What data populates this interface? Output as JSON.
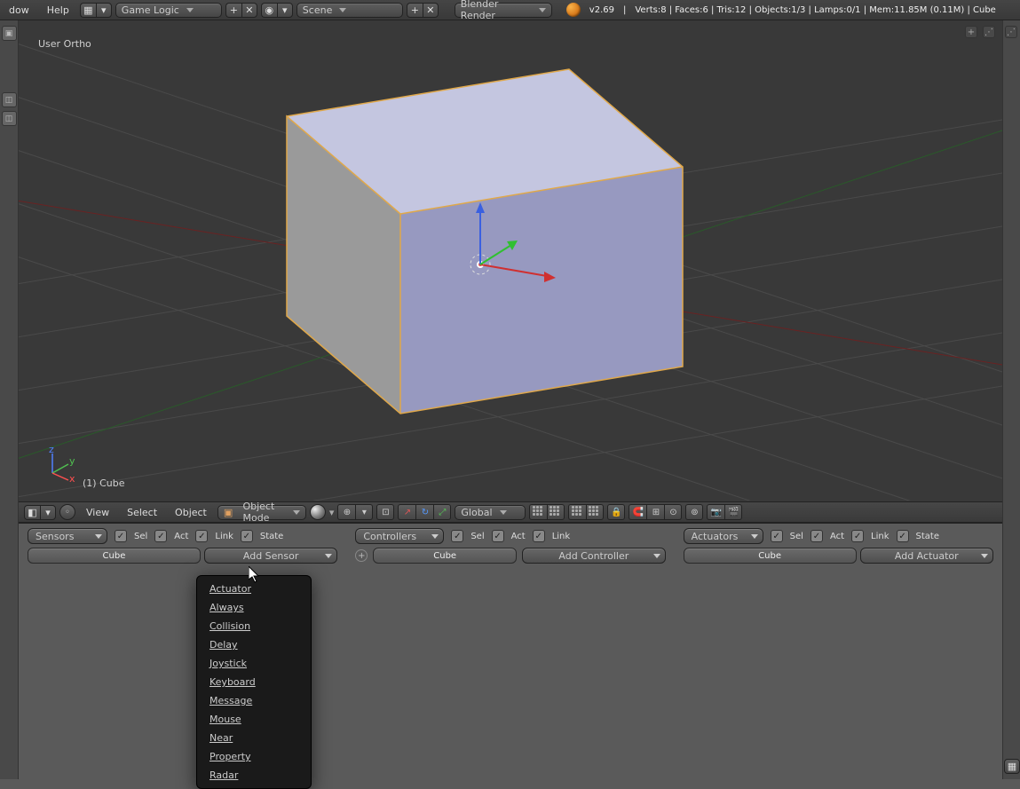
{
  "top": {
    "menus": [
      "dow",
      "Help"
    ],
    "editor_type": "Game Logic",
    "scene": "Scene",
    "render_engine": "Blender Render",
    "version": "v2.69",
    "stats": "Verts:8 | Faces:6 | Tris:12 | Objects:1/3 | Lamps:0/1 | Mem:11.85M (0.11M) | Cube"
  },
  "viewport": {
    "view_label": "User Ortho",
    "object_label": "(1) Cube"
  },
  "view_header": {
    "menus": [
      "View",
      "Select",
      "Object"
    ],
    "mode": "Object Mode",
    "orientation": "Global"
  },
  "logic": {
    "sensors": {
      "label": "Sensors",
      "checks": [
        "Sel",
        "Act",
        "Link",
        "State"
      ],
      "object": "Cube",
      "add": "Add Sensor"
    },
    "controllers": {
      "label": "Controllers",
      "checks": [
        "Sel",
        "Act",
        "Link"
      ],
      "object": "Cube",
      "add": "Add Controller"
    },
    "actuators": {
      "label": "Actuators",
      "checks": [
        "Sel",
        "Act",
        "Link",
        "State"
      ],
      "object": "Cube",
      "add": "Add Actuator"
    }
  },
  "popup": {
    "items": [
      "Actuator",
      "Always",
      "Collision",
      "Delay",
      "Joystick",
      "Keyboard",
      "Message",
      "Mouse",
      "Near",
      "Property",
      "Radar"
    ]
  }
}
